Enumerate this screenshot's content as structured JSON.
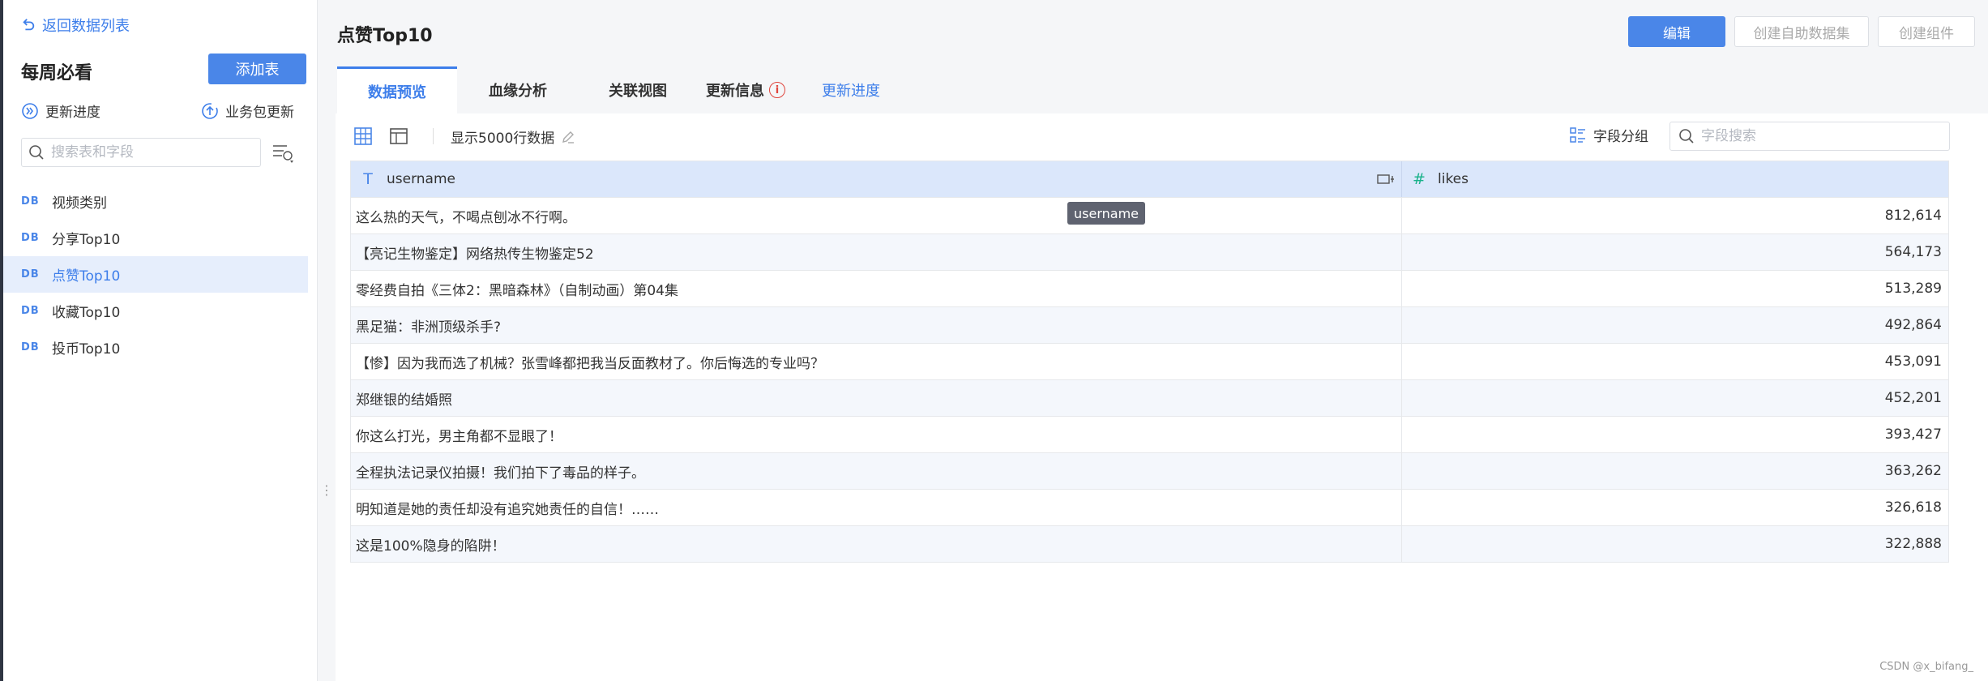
{
  "sidebar": {
    "back_label": "返回数据列表",
    "package_title": "每周必看",
    "add_table_label": "添加表",
    "update_progress_label": "更新进度",
    "package_update_label": "业务包更新",
    "search_placeholder": "搜索表和字段",
    "items": [
      {
        "label": "视频类别",
        "icon": "DB"
      },
      {
        "label": "分享Top10",
        "icon": "DB"
      },
      {
        "label": "点赞Top10",
        "icon": "DB",
        "active": true
      },
      {
        "label": "收藏Top10",
        "icon": "DB"
      },
      {
        "label": "投币Top10",
        "icon": "DB"
      }
    ]
  },
  "header": {
    "title": "点赞Top10",
    "edit_label": "编辑",
    "create_dataset_label": "创建自助数据集",
    "create_component_label": "创建组件"
  },
  "tabs": [
    {
      "label": "数据预览",
      "active": true
    },
    {
      "label": "血缘分析"
    },
    {
      "label": "关联视图"
    },
    {
      "label": "更新信息",
      "info": "i"
    },
    {
      "label": "更新进度",
      "link": true
    }
  ],
  "toolbar": {
    "rows_label": "显示5000行数据",
    "field_group_label": "字段分组",
    "field_search_placeholder": "字段搜索"
  },
  "table": {
    "columns": [
      {
        "name": "username",
        "type_glyph": "T"
      },
      {
        "name": "likes",
        "type_glyph": "#"
      }
    ],
    "rows": [
      [
        "这么热的天气，不喝点刨冰不行啊。",
        "812,614"
      ],
      [
        "【亮记生物鉴定】网络热传生物鉴定52",
        "564,173"
      ],
      [
        "零经费自拍《三体2：黑暗森林》（自制动画）第04集",
        "513,289"
      ],
      [
        "黑足猫：非洲顶级杀手?",
        "492,864"
      ],
      [
        "【惨】因为我而选了机械？张雪峰都把我当反面教材了。你后悔选的专业吗？",
        "453,091"
      ],
      [
        "郑继银的结婚照",
        "452,201"
      ],
      [
        "你这么打光，男主角都不显眼了！",
        "393,427"
      ],
      [
        "全程执法记录仪拍摄！我们拍下了毒品的样子。",
        "363,262"
      ],
      [
        "明知道是她的责任却没有追究她责任的自信！……",
        "326,618"
      ],
      [
        "这是100%隐身的陷阱！",
        "322,888"
      ]
    ],
    "tooltip": "username"
  },
  "watermark": "CSDN @x_bifang_",
  "colors": {
    "accent": "#4a86e8",
    "active_bg": "#e6eefc",
    "header_bg": "#dbe7fb",
    "info_red": "#e0463e"
  }
}
